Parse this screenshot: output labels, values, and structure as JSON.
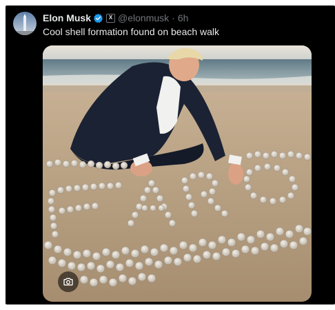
{
  "post": {
    "author_name": "Elon Musk",
    "verified_badge": "verified-badge-icon",
    "affiliation_badge": "X",
    "handle": "@elonmusk",
    "separator": "·",
    "timestamp": "6h",
    "text": "Cool shell formation found on beach walk",
    "media": {
      "description_icon": "camera-icon"
    }
  },
  "colors": {
    "background": "#000000",
    "primary_text": "#e7e9ea",
    "secondary_text": "#71767b",
    "verified_blue": "#1d9bf0"
  }
}
